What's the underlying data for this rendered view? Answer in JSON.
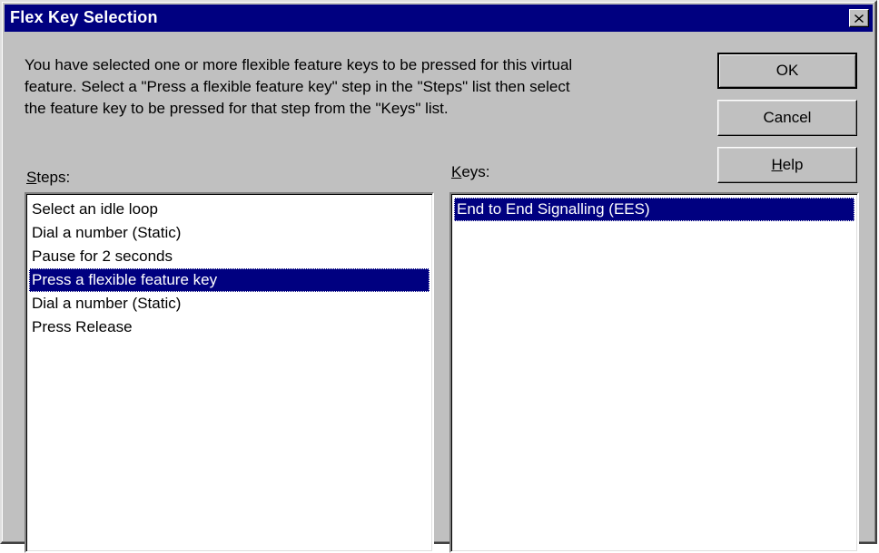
{
  "window": {
    "title": "Flex Key Selection",
    "close_icon": "close-x-icon"
  },
  "description": {
    "line1": "You have selected one or more flexible feature keys to be pressed for this virtual",
    "line2": "feature. Select a \"Press a flexible feature key\" step in the \"Steps\" list then select",
    "line3": "the feature key to be pressed for that step from the \"Keys\" list."
  },
  "buttons": {
    "ok_label": "OK",
    "cancel_label": "Cancel",
    "help_accel": "H",
    "help_rest": "elp"
  },
  "steps": {
    "label_accel": "S",
    "label_rest": "teps:",
    "items": [
      "Select an idle loop",
      "Dial a number (Static)",
      "Pause for 2 seconds",
      "Press a flexible feature key",
      "Dial a number (Static)",
      "Press Release"
    ],
    "selected_index": 3
  },
  "keys": {
    "label_accel": "K",
    "label_rest": "eys:",
    "items": [
      "End to End Signalling (EES)"
    ],
    "selected_index": 0
  },
  "colors": {
    "titlebar": "#000080",
    "face": "#c0c0c0",
    "selection": "#000080"
  }
}
